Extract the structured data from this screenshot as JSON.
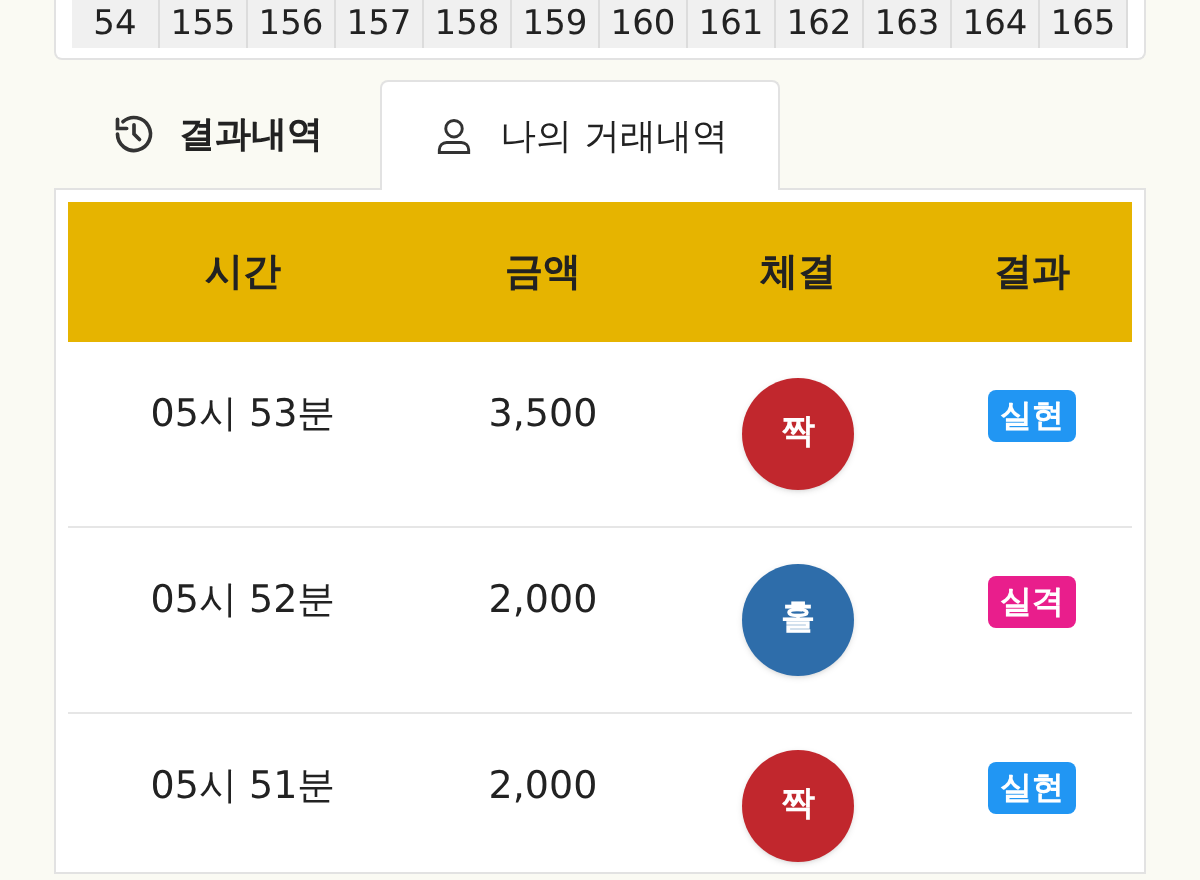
{
  "number_strip": [
    "54",
    "155",
    "156",
    "157",
    "158",
    "159",
    "160",
    "161",
    "162",
    "163",
    "164",
    "165"
  ],
  "tabs": [
    {
      "label": "결과내역",
      "kind": "history",
      "selected": false
    },
    {
      "label": "나의 거래내역",
      "kind": "user",
      "selected": true
    }
  ],
  "table": {
    "columns": [
      "시간",
      "금액",
      "체결",
      "결과"
    ],
    "rows": [
      {
        "time": "05시 53분",
        "amount": "3,500",
        "pick": {
          "label": "짝",
          "color": "#c1272d"
        },
        "result": {
          "label": "실현",
          "color": "#2196f3"
        }
      },
      {
        "time": "05시 52분",
        "amount": "2,000",
        "pick": {
          "label": "홀",
          "color": "#2e6daa"
        },
        "result": {
          "label": "실격",
          "color": "#e91e8c"
        }
      },
      {
        "time": "05시 51분",
        "amount": "2,000",
        "pick": {
          "label": "짝",
          "color": "#c1272d"
        },
        "result": {
          "label": "실현",
          "color": "#2196f3"
        }
      }
    ]
  }
}
